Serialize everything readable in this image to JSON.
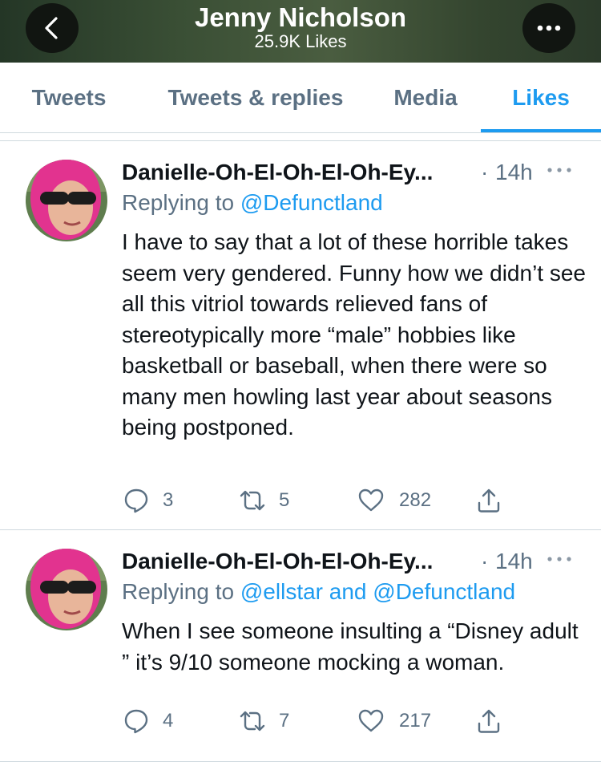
{
  "header": {
    "title": "Jenny Nicholson",
    "subtitle": "25.9K Likes",
    "back_icon": "chevron-left-icon",
    "menu_icon": "ellipsis-icon"
  },
  "tabs": [
    {
      "label": "Tweets",
      "active": false
    },
    {
      "label": "Tweets & replies",
      "active": false
    },
    {
      "label": "Media",
      "active": false
    },
    {
      "label": "Likes",
      "active": true
    }
  ],
  "colors": {
    "accent": "#1d9bf0",
    "muted": "#5b7083",
    "text": "#0f1419",
    "divider": "#cfd9de"
  },
  "tweets": [
    {
      "author": "Danielle-Oh-El-Oh-El-Oh-Ey...",
      "separator": "·",
      "time": "14h",
      "replying_prefix": "Replying to ",
      "replying_handles": "@Defunctland",
      "text": "I have to say that a lot of these horrible takes seem very gendered. Funny how we didn’t see all this vitriol towards relieved fans of stereotypically more “male” hobbies like basketball or baseball, when there were so many men howling last year about seasons being postponed.",
      "replies": "3",
      "retweets": "5",
      "likes": "282"
    },
    {
      "author": "Danielle-Oh-El-Oh-El-Oh-Ey...",
      "separator": "·",
      "time": "14h",
      "replying_prefix": "Replying to ",
      "replying_handles": "@ellstar and @Defunctland",
      "text": "When I see someone insulting a “Disney adult ” it’s 9/10 someone mocking a woman.",
      "replies": "4",
      "retweets": "7",
      "likes": "217"
    }
  ]
}
